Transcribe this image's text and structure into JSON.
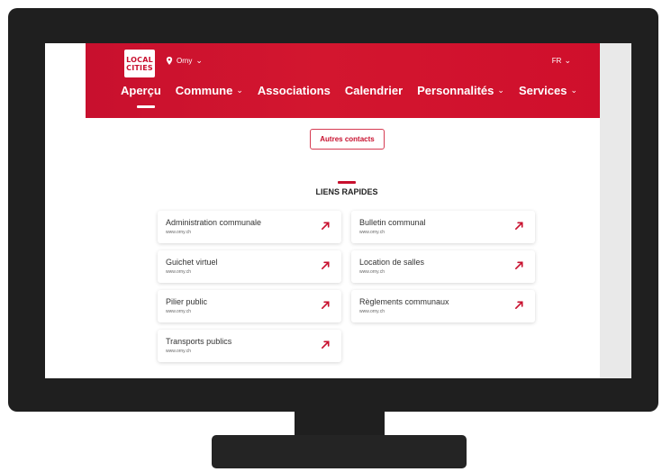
{
  "header": {
    "logo_line1": "LOCAL",
    "logo_line2": "CITIES",
    "location": "Orny",
    "language": "FR"
  },
  "nav": [
    {
      "label": "Aperçu",
      "has_dropdown": false,
      "active": true
    },
    {
      "label": "Commune",
      "has_dropdown": true
    },
    {
      "label": "Associations",
      "has_dropdown": false
    },
    {
      "label": "Calendrier",
      "has_dropdown": false
    },
    {
      "label": "Personnalités",
      "has_dropdown": true
    },
    {
      "label": "Services",
      "has_dropdown": true
    }
  ],
  "contacts_button": "Autres contacts",
  "quick_links": {
    "title": "LIENS RAPIDES",
    "items": [
      {
        "title": "Administration communale",
        "url": "www.orny.ch"
      },
      {
        "title": "Bulletin communal",
        "url": "www.orny.ch"
      },
      {
        "title": "Guichet virtuel",
        "url": "www.orny.ch"
      },
      {
        "title": "Location de salles",
        "url": "www.orny.ch"
      },
      {
        "title": "Pilier public",
        "url": "www.orny.ch"
      },
      {
        "title": "Règlements communaux",
        "url": "www.orny.ch"
      },
      {
        "title": "Transports publics",
        "url": "www.orny.ch"
      }
    ]
  },
  "colors": {
    "brand_red": "#c8102e",
    "bezel": "#1f1f1f"
  },
  "icons": {
    "location": "pin-icon",
    "dropdown": "chevron-down-icon",
    "link": "arrow-up-right-icon"
  }
}
